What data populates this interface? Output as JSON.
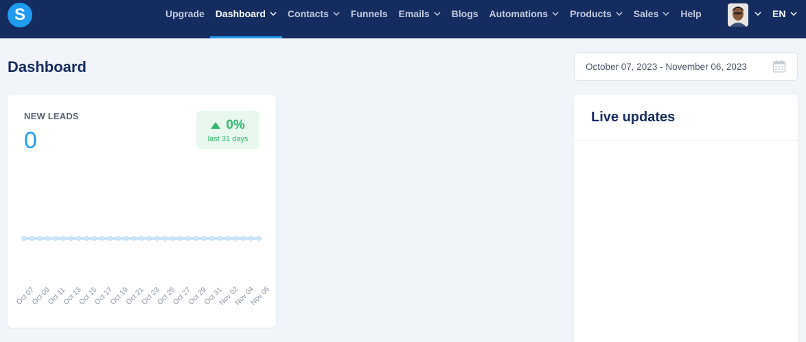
{
  "app": {
    "logo_letter": "S"
  },
  "nav": {
    "items": [
      {
        "label": "Upgrade",
        "has_dropdown": false,
        "active": false
      },
      {
        "label": "Dashboard",
        "has_dropdown": true,
        "active": true
      },
      {
        "label": "Contacts",
        "has_dropdown": true,
        "active": false
      },
      {
        "label": "Funnels",
        "has_dropdown": false,
        "active": false
      },
      {
        "label": "Emails",
        "has_dropdown": true,
        "active": false
      },
      {
        "label": "Blogs",
        "has_dropdown": false,
        "active": false
      },
      {
        "label": "Automations",
        "has_dropdown": true,
        "active": false
      },
      {
        "label": "Products",
        "has_dropdown": true,
        "active": false
      },
      {
        "label": "Sales",
        "has_dropdown": true,
        "active": false
      },
      {
        "label": "Help",
        "has_dropdown": false,
        "active": false
      }
    ],
    "language": "EN"
  },
  "page": {
    "title": "Dashboard",
    "date_range": "October 07, 2023 - November 06, 2023"
  },
  "leads_card": {
    "label": "NEW LEADS",
    "value": "0",
    "trend_value": "0%",
    "trend_period": "last 31 days"
  },
  "live_updates": {
    "title": "Live updates"
  },
  "colors": {
    "nav_bg": "#142c5f",
    "accent": "#1f9bf0",
    "positive": "#2dba6a",
    "line": "#b9dbf6"
  },
  "chart_data": {
    "type": "line",
    "x": [
      "Oct 07",
      "Oct 08",
      "Oct 09",
      "Oct 10",
      "Oct 11",
      "Oct 12",
      "Oct 13",
      "Oct 14",
      "Oct 15",
      "Oct 16",
      "Oct 17",
      "Oct 18",
      "Oct 19",
      "Oct 20",
      "Oct 21",
      "Oct 22",
      "Oct 23",
      "Oct 24",
      "Oct 25",
      "Oct 26",
      "Oct 27",
      "Oct 28",
      "Oct 29",
      "Oct 30",
      "Oct 31",
      "Nov 01",
      "Nov 02",
      "Nov 03",
      "Nov 04",
      "Nov 05",
      "Nov 06"
    ],
    "tick_labels": [
      "Oct 07",
      "Oct 09",
      "Oct 11",
      "Oct 13",
      "Oct 15",
      "Oct 17",
      "Oct 19",
      "Oct 21",
      "Oct 23",
      "Oct 25",
      "Oct 27",
      "Oct 29",
      "Oct 31",
      "Nov 02",
      "Nov 04",
      "Nov 06"
    ],
    "series": [
      {
        "values": [
          0,
          0,
          0,
          0,
          0,
          0,
          0,
          0,
          0,
          0,
          0,
          0,
          0,
          0,
          0,
          0,
          0,
          0,
          0,
          0,
          0,
          0,
          0,
          0,
          0,
          0,
          0,
          0,
          0,
          0,
          0
        ]
      }
    ],
    "grid": false,
    "legend": false
  }
}
